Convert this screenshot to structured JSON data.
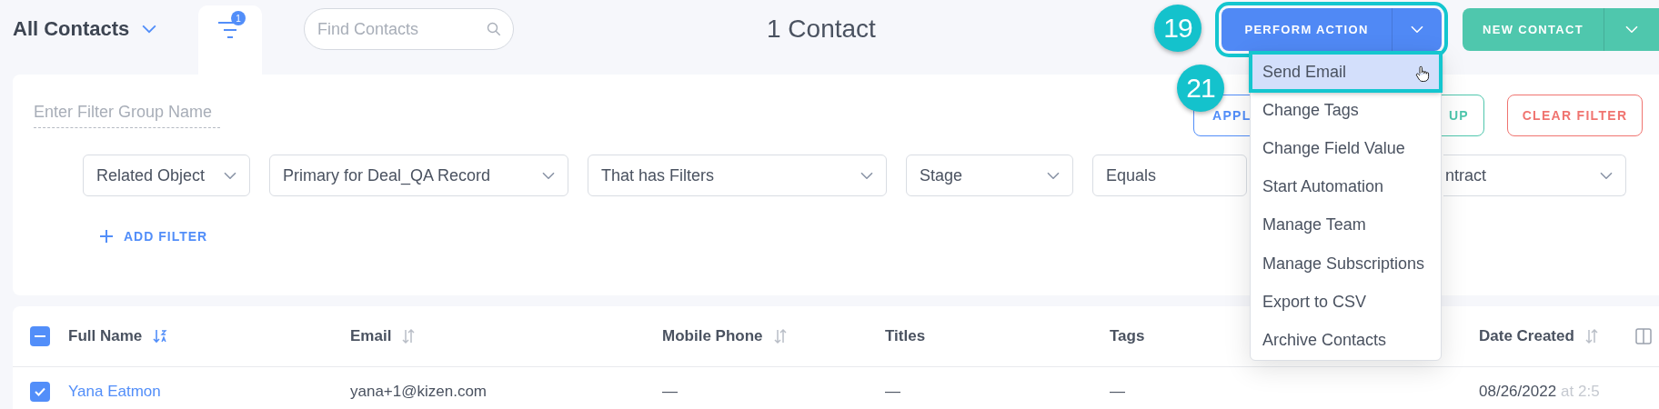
{
  "header": {
    "view_title": "All Contacts",
    "filter_count": "1",
    "search": {
      "placeholder": "Find Contacts"
    },
    "record_count": "1 Contact",
    "perform_action": {
      "label": "PERFORM ACTION",
      "highlighted": true
    },
    "new_contact": {
      "label": "NEW CONTACT"
    }
  },
  "filter_panel": {
    "group_name": {
      "placeholder": "Enter Filter Group Name"
    },
    "buttons": [
      {
        "label": "APPL",
        "kind": "apply"
      },
      {
        "label": "UP",
        "kind": "save"
      },
      {
        "label": "CLEAR FILTER",
        "kind": "clear"
      }
    ],
    "filters": [
      {
        "value": "Related Object"
      },
      {
        "value": "Primary for Deal_QA Record"
      },
      {
        "value": "That has Filters"
      },
      {
        "value": "Stage"
      },
      {
        "value": "Equals"
      },
      {
        "value": "ntract"
      }
    ],
    "add_filter": "ADD FILTER"
  },
  "action_menu": [
    {
      "label": "Send Email",
      "selected": true,
      "highlighted": true
    },
    {
      "label": "Change Tags",
      "selected": false,
      "highlighted": false
    },
    {
      "label": "Change Field Value",
      "selected": false,
      "highlighted": false
    },
    {
      "label": "Start Automation",
      "selected": false,
      "highlighted": false
    },
    {
      "label": "Manage Team",
      "selected": false,
      "highlighted": false
    },
    {
      "label": "Manage Subscriptions",
      "selected": false,
      "highlighted": false
    },
    {
      "label": "Export to CSV",
      "selected": false,
      "highlighted": false
    },
    {
      "label": "Archive Contacts",
      "selected": false,
      "highlighted": false
    }
  ],
  "annotations": [
    {
      "label": "19"
    },
    {
      "label": "21"
    }
  ],
  "table": {
    "select_all": {
      "indeterminate": true
    },
    "columns": [
      {
        "label": "Full Name",
        "sortable": true,
        "sort_active": true
      },
      {
        "label": "Email",
        "sortable": true,
        "sort_active": false
      },
      {
        "label": "Mobile Phone",
        "sortable": true,
        "sort_active": false
      },
      {
        "label": "Titles",
        "sortable": false
      },
      {
        "label": "Tags",
        "sortable": false
      },
      {
        "label": "Date Created",
        "sortable": true,
        "sort_active": false
      }
    ],
    "rows": [
      {
        "checked": true,
        "full_name": "Yana Eatmon",
        "email": "yana+1@kizen.com",
        "mobile_phone": "—",
        "titles": "—",
        "tags": "—",
        "date_created": "08/26/2022",
        "time_created": "at 2:5"
      }
    ]
  }
}
